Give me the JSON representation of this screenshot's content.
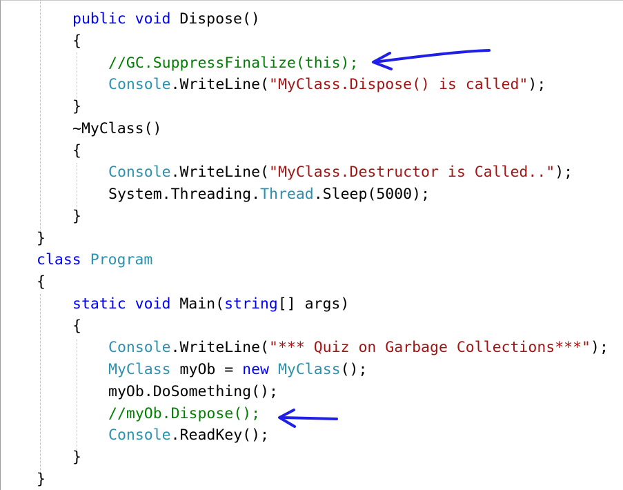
{
  "colors": {
    "keyword": "#0000ff",
    "type": "#2b91af",
    "string": "#a31515",
    "comment": "#008000",
    "plain": "#000000",
    "annotation_arrow": "#1f1fe6"
  },
  "code": {
    "lines": [
      {
        "indent": 1,
        "tokens": [
          {
            "t": "kw",
            "v": "public"
          },
          {
            "t": "pl",
            "v": " "
          },
          {
            "t": "kw",
            "v": "void"
          },
          {
            "t": "pl",
            "v": " Dispose()"
          }
        ]
      },
      {
        "indent": 1,
        "tokens": [
          {
            "t": "pl",
            "v": "{"
          }
        ]
      },
      {
        "indent": 2,
        "tokens": [
          {
            "t": "cm",
            "v": "//GC.SuppressFinalize(this);"
          }
        ]
      },
      {
        "indent": 2,
        "tokens": [
          {
            "t": "ty",
            "v": "Console"
          },
          {
            "t": "pl",
            "v": ".WriteLine("
          },
          {
            "t": "st",
            "v": "\"MyClass.Dispose() is called\""
          },
          {
            "t": "pl",
            "v": ");"
          }
        ]
      },
      {
        "indent": 1,
        "tokens": [
          {
            "t": "pl",
            "v": "}"
          }
        ]
      },
      {
        "indent": 1,
        "tokens": [
          {
            "t": "pl",
            "v": "~MyClass()"
          }
        ]
      },
      {
        "indent": 1,
        "tokens": [
          {
            "t": "pl",
            "v": "{"
          }
        ]
      },
      {
        "indent": 2,
        "tokens": [
          {
            "t": "ty",
            "v": "Console"
          },
          {
            "t": "pl",
            "v": ".WriteLine("
          },
          {
            "t": "st",
            "v": "\"MyClass.Destructor is Called..\""
          },
          {
            "t": "pl",
            "v": ");"
          }
        ]
      },
      {
        "indent": 2,
        "tokens": [
          {
            "t": "pl",
            "v": "System.Threading."
          },
          {
            "t": "ty",
            "v": "Thread"
          },
          {
            "t": "pl",
            "v": ".Sleep(5000);"
          }
        ]
      },
      {
        "indent": 1,
        "tokens": [
          {
            "t": "pl",
            "v": "}"
          }
        ]
      },
      {
        "indent": 0,
        "tokens": [
          {
            "t": "pl",
            "v": "}"
          }
        ]
      },
      {
        "indent": 0,
        "tokens": [
          {
            "t": "kw",
            "v": "class"
          },
          {
            "t": "pl",
            "v": " "
          },
          {
            "t": "ty",
            "v": "Program"
          }
        ]
      },
      {
        "indent": 0,
        "tokens": [
          {
            "t": "pl",
            "v": "{"
          }
        ]
      },
      {
        "indent": 1,
        "tokens": [
          {
            "t": "kw",
            "v": "static"
          },
          {
            "t": "pl",
            "v": " "
          },
          {
            "t": "kw",
            "v": "void"
          },
          {
            "t": "pl",
            "v": " Main("
          },
          {
            "t": "kw",
            "v": "string"
          },
          {
            "t": "pl",
            "v": "[] args)"
          }
        ]
      },
      {
        "indent": 1,
        "tokens": [
          {
            "t": "pl",
            "v": "{"
          }
        ]
      },
      {
        "indent": 2,
        "tokens": [
          {
            "t": "ty",
            "v": "Console"
          },
          {
            "t": "pl",
            "v": ".WriteLine("
          },
          {
            "t": "st",
            "v": "\"*** Quiz on Garbage Collections***\""
          },
          {
            "t": "pl",
            "v": ");"
          }
        ]
      },
      {
        "indent": 2,
        "tokens": [
          {
            "t": "ty",
            "v": "MyClass"
          },
          {
            "t": "pl",
            "v": " myOb = "
          },
          {
            "t": "kw",
            "v": "new"
          },
          {
            "t": "pl",
            "v": " "
          },
          {
            "t": "ty",
            "v": "MyClass"
          },
          {
            "t": "pl",
            "v": "();"
          }
        ]
      },
      {
        "indent": 2,
        "tokens": [
          {
            "t": "pl",
            "v": "myOb.DoSomething();"
          }
        ]
      },
      {
        "indent": 2,
        "tokens": [
          {
            "t": "cm",
            "v": "//myOb.Dispose();"
          }
        ]
      },
      {
        "indent": 2,
        "tokens": [
          {
            "t": "ty",
            "v": "Console"
          },
          {
            "t": "pl",
            "v": ".ReadKey();"
          }
        ]
      },
      {
        "indent": 1,
        "tokens": [
          {
            "t": "pl",
            "v": "}"
          }
        ]
      },
      {
        "indent": 0,
        "tokens": [
          {
            "t": "pl",
            "v": "}"
          }
        ]
      }
    ]
  },
  "annotations": [
    {
      "icon": "blue-hand-drawn-arrow-icon",
      "points_to_line": 3
    },
    {
      "icon": "blue-hand-drawn-arrow-icon",
      "points_to_line": 19
    }
  ]
}
